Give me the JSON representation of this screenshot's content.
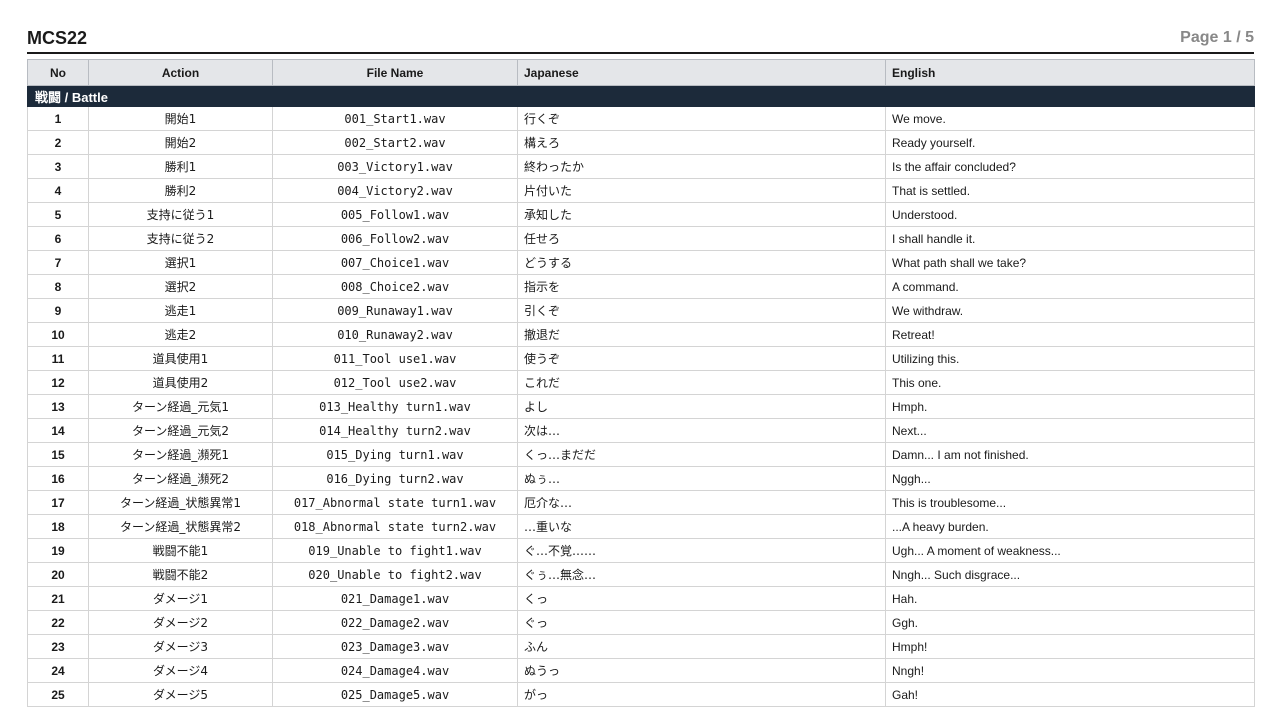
{
  "document": {
    "title": "MCS22",
    "page_label": "Page 1 / 5"
  },
  "table": {
    "headers": {
      "no": "No",
      "action": "Action",
      "file": "File Name",
      "japanese": "Japanese",
      "english": "English"
    },
    "section": "戦闘 / Battle",
    "rows": [
      {
        "no": "1",
        "action": "開始1",
        "file": "001_Start1.wav",
        "japanese": "行くぞ",
        "english": "We move."
      },
      {
        "no": "2",
        "action": "開始2",
        "file": "002_Start2.wav",
        "japanese": "構えろ",
        "english": "Ready yourself."
      },
      {
        "no": "3",
        "action": "勝利1",
        "file": "003_Victory1.wav",
        "japanese": "終わったか",
        "english": "Is the affair concluded?"
      },
      {
        "no": "4",
        "action": "勝利2",
        "file": "004_Victory2.wav",
        "japanese": "片付いた",
        "english": "That is settled."
      },
      {
        "no": "5",
        "action": "支持に従う1",
        "file": "005_Follow1.wav",
        "japanese": "承知した",
        "english": "Understood."
      },
      {
        "no": "6",
        "action": "支持に従う2",
        "file": "006_Follow2.wav",
        "japanese": "任せろ",
        "english": "I shall handle it."
      },
      {
        "no": "7",
        "action": "選択1",
        "file": "007_Choice1.wav",
        "japanese": "どうする",
        "english": "What path shall we take?"
      },
      {
        "no": "8",
        "action": "選択2",
        "file": "008_Choice2.wav",
        "japanese": "指示を",
        "english": "A command."
      },
      {
        "no": "9",
        "action": "逃走1",
        "file": "009_Runaway1.wav",
        "japanese": "引くぞ",
        "english": "We withdraw."
      },
      {
        "no": "10",
        "action": "逃走2",
        "file": "010_Runaway2.wav",
        "japanese": "撤退だ",
        "english": "Retreat!"
      },
      {
        "no": "11",
        "action": "道具使用1",
        "file": "011_Tool use1.wav",
        "japanese": "使うぞ",
        "english": "Utilizing this."
      },
      {
        "no": "12",
        "action": "道具使用2",
        "file": "012_Tool use2.wav",
        "japanese": "これだ",
        "english": "This one."
      },
      {
        "no": "13",
        "action": "ターン経過_元気1",
        "file": "013_Healthy turn1.wav",
        "japanese": "よし",
        "english": "Hmph."
      },
      {
        "no": "14",
        "action": "ターン経過_元気2",
        "file": "014_Healthy turn2.wav",
        "japanese": "次は…",
        "english": "Next..."
      },
      {
        "no": "15",
        "action": "ターン経過_瀕死1",
        "file": "015_Dying turn1.wav",
        "japanese": "くっ…まだだ",
        "english": "Damn... I am not finished."
      },
      {
        "no": "16",
        "action": "ターン経過_瀕死2",
        "file": "016_Dying turn2.wav",
        "japanese": "ぬぅ…",
        "english": "Nggh..."
      },
      {
        "no": "17",
        "action": "ターン経過_状態異常1",
        "file": "017_Abnormal state turn1.wav",
        "japanese": "厄介な…",
        "english": "This is troublesome..."
      },
      {
        "no": "18",
        "action": "ターン経過_状態異常2",
        "file": "018_Abnormal state turn2.wav",
        "japanese": "…重いな",
        "english": "...A heavy burden."
      },
      {
        "no": "19",
        "action": "戦闘不能1",
        "file": "019_Unable to fight1.wav",
        "japanese": "ぐ…不覚……",
        "english": "Ugh... A moment of weakness..."
      },
      {
        "no": "20",
        "action": "戦闘不能2",
        "file": "020_Unable to fight2.wav",
        "japanese": "ぐぅ…無念…",
        "english": "Nngh... Such disgrace..."
      },
      {
        "no": "21",
        "action": "ダメージ1",
        "file": "021_Damage1.wav",
        "japanese": "くっ",
        "english": "Hah."
      },
      {
        "no": "22",
        "action": "ダメージ2",
        "file": "022_Damage2.wav",
        "japanese": "ぐっ",
        "english": "Ggh."
      },
      {
        "no": "23",
        "action": "ダメージ3",
        "file": "023_Damage3.wav",
        "japanese": "ふん",
        "english": "Hmph!"
      },
      {
        "no": "24",
        "action": "ダメージ4",
        "file": "024_Damage4.wav",
        "japanese": "ぬうっ",
        "english": "Nngh!"
      },
      {
        "no": "25",
        "action": "ダメージ5",
        "file": "025_Damage5.wav",
        "japanese": "がっ",
        "english": "Gah!"
      }
    ]
  }
}
